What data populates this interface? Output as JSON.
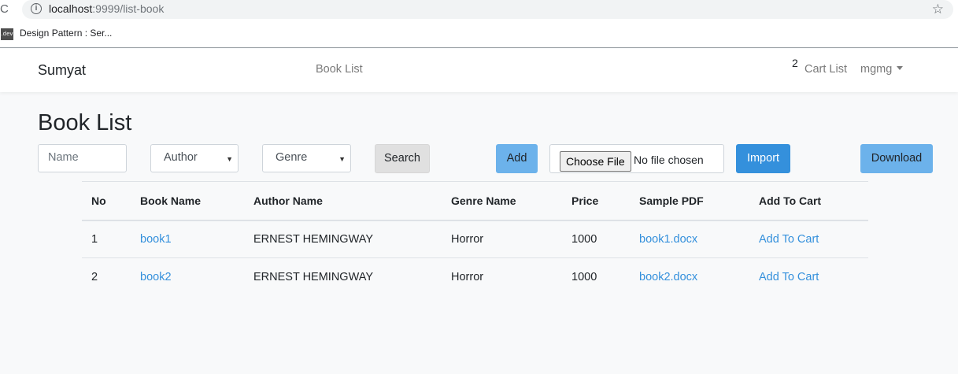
{
  "browser": {
    "url_host": "localhost",
    "url_rest": ":9999/list-book",
    "bookmark_favicon": ".dev",
    "bookmark_label": "Design Pattern : Ser..."
  },
  "navbar": {
    "brand": "Sumyat",
    "book_list": "Book List",
    "cart_count": "2",
    "cart_list": "Cart List",
    "user": "mgmg"
  },
  "page": {
    "title": "Book List",
    "name_placeholder": "Name",
    "author_select": "Author",
    "genre_select": "Genre",
    "search_label": "Search",
    "add_label": "Add",
    "choose_file_label": "Choose File",
    "no_file_label": "No file chosen",
    "import_label": "Import",
    "download_label": "Download"
  },
  "table": {
    "headers": [
      "No",
      "Book Name",
      "Author Name",
      "Genre Name",
      "Price",
      "Sample PDF",
      "Add To Cart"
    ],
    "rows": [
      [
        "1",
        "book1",
        "ERNEST HEMINGWAY",
        "Horror",
        "1000",
        "book1.docx",
        "Add To Cart"
      ],
      [
        "2",
        "book2",
        "ERNEST HEMINGWAY",
        "Horror",
        "1000",
        "book2.docx",
        "Add To Cart"
      ]
    ]
  },
  "colors": {
    "primary": "#3490dc",
    "info": "#6cb2eb",
    "background": "#f8f9fa"
  }
}
